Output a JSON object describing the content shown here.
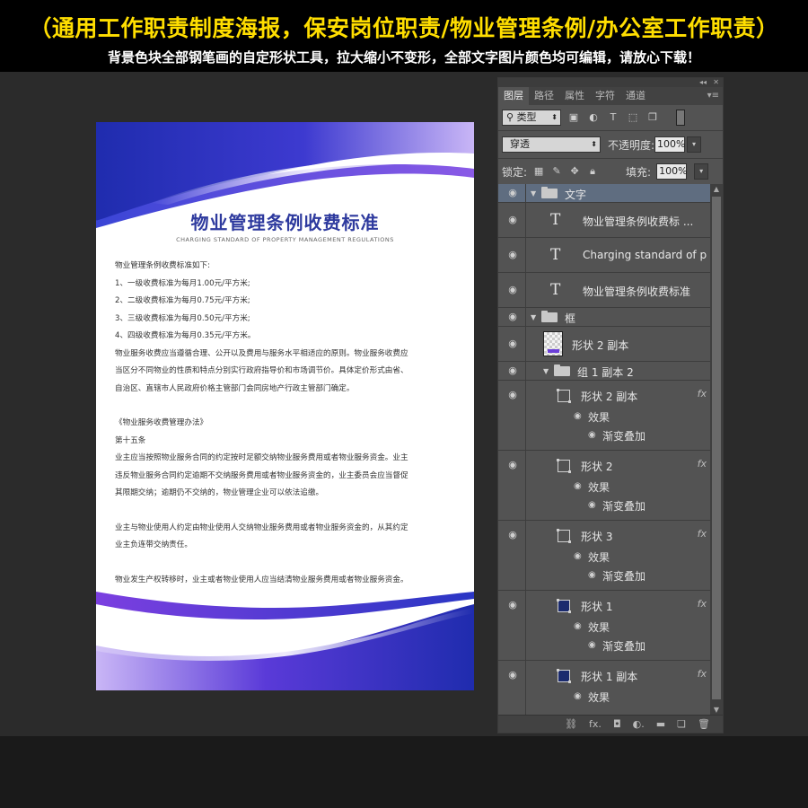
{
  "banner": {
    "title": "（通用工作职责制度海报，保安岗位职责/物业管理条例/办公室工作职责）",
    "subtitle": "背景色块全部钢笔画的自定形状工具，拉大缩小不变形，全部文字图片颜色均可编辑，请放心下载！"
  },
  "poster": {
    "title": "物业管理条例收费标准",
    "subtitle": "CHARGING STANDARD OF PROPERTY MANAGEMENT REGULATIONS",
    "lines": [
      "物业管理条例收费标准如下:",
      "1、一级收费标准为每月1.00元/平方米;",
      "2、二级收费标准为每月0.75元/平方米;",
      "3、三级收费标准为每月0.50元/平方米;",
      "4、四级收费标准为每月0.35元/平方米。",
      "物业服务收费应当遵循合理、公开以及费用与服务水平相适应的原则。物业服务收费应",
      "当区分不同物业的性质和特点分别实行政府指导价和市场调节价。具体定价形式由省、",
      "自治区、直辖市人民政府价格主管部门会同房地产行政主管部门确定。",
      "",
      "《物业服务收费管理办法》",
      "第十五条",
      "业主应当按照物业服务合同的约定按时足额交纳物业服务费用或者物业服务资金。业主",
      "违反物业服务合同约定逾期不交纳服务费用或者物业服务资金的，业主委员会应当督促",
      "其限期交纳；逾期仍不交纳的，物业管理企业可以依法追缴。",
      "",
      "业主与物业使用人约定由物业使用人交纳物业服务费用或者物业服务资金的，从其约定",
      "业主负连带交纳责任。",
      "",
      "物业发生产权转移时，业主或者物业使用人应当结清物业服务费用或者物业服务资金。"
    ]
  },
  "panel": {
    "tabs": [
      "图层",
      "路径",
      "属性",
      "字符",
      "通道"
    ],
    "active_tab": "图层",
    "filter_kind": "类型",
    "blend_mode": "穿透",
    "opacity_label": "不透明度:",
    "opacity_value": "100%",
    "lock_label": "锁定:",
    "fill_label": "填充:",
    "fill_value": "100%",
    "layers": {
      "group_text": "文字",
      "text1": "物业管理条例收费标 ...",
      "text2": "Charging standard of pr...",
      "text3": "物业管理条例收费标准",
      "group_frame": "框",
      "shape2": "形状 2 副本",
      "group1": "组 1 副本 2",
      "fx_layers": [
        {
          "name": "形状 2 副本",
          "effect": "效果",
          "sub": "渐变叠加"
        },
        {
          "name": "形状 2",
          "effect": "效果",
          "sub": "渐变叠加"
        },
        {
          "name": "形状 3",
          "effect": "效果",
          "sub": "渐变叠加"
        },
        {
          "name": "形状 1",
          "effect": "效果",
          "sub": "渐变叠加"
        },
        {
          "name": "形状 1 副本",
          "effect": "效果",
          "sub": ""
        }
      ],
      "fx": "fx"
    }
  },
  "colors": {
    "banner_text": "#ffde00",
    "poster_title": "#2e3a9e",
    "wave_blue": "#2130b8",
    "wave_purple": "#7b3fe0",
    "panel_bg": "#535353",
    "selected_row": "#5f6d80"
  }
}
